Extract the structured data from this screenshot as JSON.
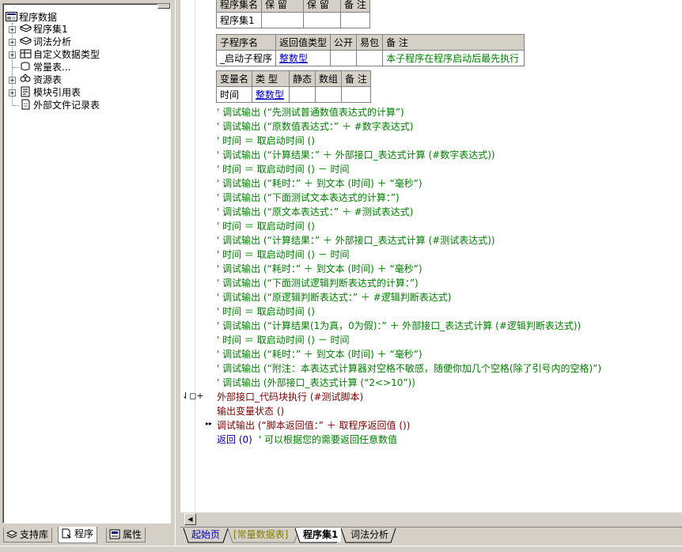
{
  "tree": {
    "root": "程序数据",
    "items": [
      {
        "label": "程序集1",
        "icon": "module-icon",
        "expandable": true
      },
      {
        "label": "词法分析",
        "icon": "module-icon",
        "expandable": true
      },
      {
        "label": "自定义数据类型",
        "icon": "datatype-icon",
        "expandable": true
      },
      {
        "label": "常量表...",
        "icon": "constant-icon",
        "expandable": false
      },
      {
        "label": "资源表",
        "icon": "resource-icon",
        "expandable": true
      },
      {
        "label": "模块引用表",
        "icon": "module-ref-icon",
        "expandable": true
      },
      {
        "label": "外部文件记录表",
        "icon": "file-icon",
        "expandable": false
      }
    ]
  },
  "left_tabs": [
    {
      "label": "支持库",
      "icon": "library-icon"
    },
    {
      "label": "程序",
      "icon": "program-icon",
      "active": true
    },
    {
      "label": "属性",
      "icon": "property-icon"
    }
  ],
  "assembly_table": {
    "headers": [
      "程序集名",
      "保 留",
      "保 留",
      "备 注"
    ],
    "row": [
      "程序集1",
      "",
      "",
      ""
    ]
  },
  "sub_table": {
    "headers": [
      "子程序名",
      "返回值类型",
      "公开",
      "易包",
      "备 注"
    ],
    "row": [
      "_启动子程序",
      "整数型",
      "",
      "",
      "本子程序在程序启动后最先执行"
    ]
  },
  "var_table": {
    "headers": [
      "变量名",
      "类 型",
      "静态",
      "数组",
      "备 注"
    ],
    "row": [
      "时间",
      "整数型",
      "",
      "",
      ""
    ]
  },
  "code_lines": [
    {
      "type": "comment",
      "text": "' 调试输出 (“先测试普通数值表达式的计算”)"
    },
    {
      "type": "comment",
      "text": "' 调试输出 (“原数值表达式：” ＋ #数字表达式)"
    },
    {
      "type": "comment",
      "text": "' 时间 ＝ 取启动时间 ()"
    },
    {
      "type": "comment",
      "text": "' 调试输出 (“计算结果：” ＋ 外部接口_表达式计算 (#数字表达式))"
    },
    {
      "type": "comment",
      "text": "' 时间 ＝ 取启动时间 () － 时间"
    },
    {
      "type": "comment",
      "text": "' 调试输出 (“耗时：” ＋ 到文本 (时间) ＋ “毫秒”)"
    },
    {
      "type": "comment",
      "text": "' 调试输出 (“下面测试文本表达式的计算：”)"
    },
    {
      "type": "comment",
      "text": "' 调试输出 (“原文本表达式：” ＋ #测试表达式)"
    },
    {
      "type": "comment",
      "text": "' 时间 ＝ 取启动时间 ()"
    },
    {
      "type": "comment",
      "text": "' 调试输出 (“计算结果：” ＋ 外部接口_表达式计算 (#测试表达式))"
    },
    {
      "type": "comment",
      "text": "' 时间 ＝ 取启动时间 () － 时间"
    },
    {
      "type": "comment",
      "text": "' 调试输出 (“耗时：” ＋ 到文本 (时间) ＋ “毫秒”)"
    },
    {
      "type": "comment",
      "text": "' 调试输出 (“下面测试逻辑判断表达式的计算：”)"
    },
    {
      "type": "comment",
      "text": "' 调试输出 (“原逻辑判断表达式：” ＋ #逻辑判断表达式)"
    },
    {
      "type": "comment",
      "text": "' 时间 ＝ 取启动时间 ()"
    },
    {
      "type": "comment",
      "text": "' 调试输出 (“计算结果(1为真，0为假)：” ＋ 外部接口_表达式计算 (#逻辑判断表达式))"
    },
    {
      "type": "comment",
      "text": "' 时间 ＝ 取启动时间 () － 时间"
    },
    {
      "type": "comment",
      "text": "' 调试输出 (“耗时：” ＋ 到文本 (时间) ＋ “毫秒”)"
    },
    {
      "type": "comment",
      "text": "' 调试输出 (“附注：本表达式计算器对空格不敏感，随便你加几个空格(除了引号内的空格)”)"
    },
    {
      "type": "comment",
      "text": "' 调试输出 (外部接口_表达式计算 (“2<>10”))"
    },
    {
      "type": "cmd",
      "text": "外部接口_代码块执行 (#测试脚本)"
    },
    {
      "type": "cmd",
      "text": "输出变量状态 ()"
    },
    {
      "type": "cmd",
      "text": "调试输出 (“脚本返回值：” ＋ 取程序返回值 ())"
    },
    {
      "type": "kw",
      "text": "返回 (0)"
    }
  ],
  "return_comment": "' 可以根据您的需要返回任意数值",
  "gutter": {
    "breakpoint_marker": "⇃◻+",
    "current_marker": "▸▸"
  },
  "doc_tabs": [
    {
      "label": "起始页"
    },
    {
      "label": "[常量数据表]"
    },
    {
      "label": "程序集1",
      "active": true
    },
    {
      "label": "词法分析"
    }
  ],
  "colors": {
    "comment": "#008000",
    "command": "#800000",
    "keyword": "#0000a0",
    "link": "#0000c0"
  }
}
